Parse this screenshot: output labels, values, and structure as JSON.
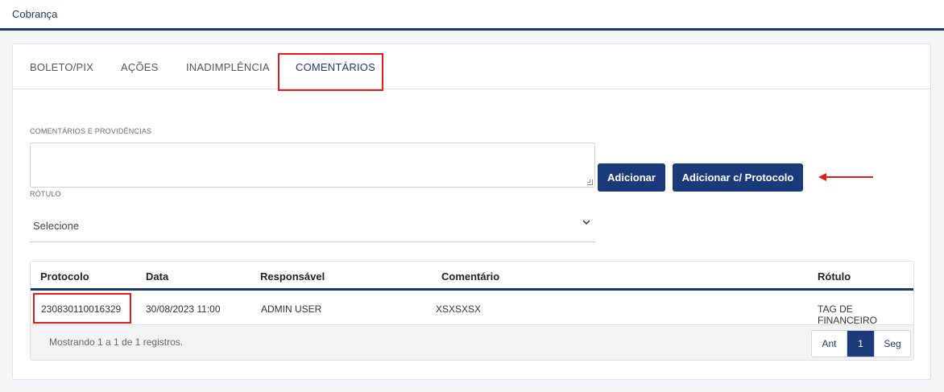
{
  "header": {
    "title": "Cobrança"
  },
  "tabs": [
    {
      "label": "BOLETO/PIX"
    },
    {
      "label": "AÇÕES"
    },
    {
      "label": "INADIMPLÊNCIA"
    },
    {
      "label": "COMENTÁRIOS",
      "active": true
    }
  ],
  "form": {
    "comments_label": "COMENTÁRIOS E PROVIDÊNCIAS",
    "comments_value": "",
    "rotulo_label": "RÓTULO",
    "rotulo_value": "Selecione",
    "add_label": "Adicionar",
    "add_protocol_label": "Adicionar c/ Protocolo"
  },
  "table": {
    "columns": [
      "Protocolo",
      "Data",
      "Responsável",
      "Comentário",
      "Rótulo"
    ],
    "rows": [
      [
        "230830110016329",
        "30/08/2023 11:00",
        "ADMIN USER",
        "XSXSXSX",
        "TAG DE FINANCEIRO"
      ]
    ],
    "footer_info": "Mostrando 1 a 1 de 1 registros."
  },
  "pagination": {
    "prev": "Ant",
    "current": "1",
    "next": "Seg"
  },
  "colors": {
    "primary": "#1b3a7a",
    "highlight": "#e31b1b"
  }
}
